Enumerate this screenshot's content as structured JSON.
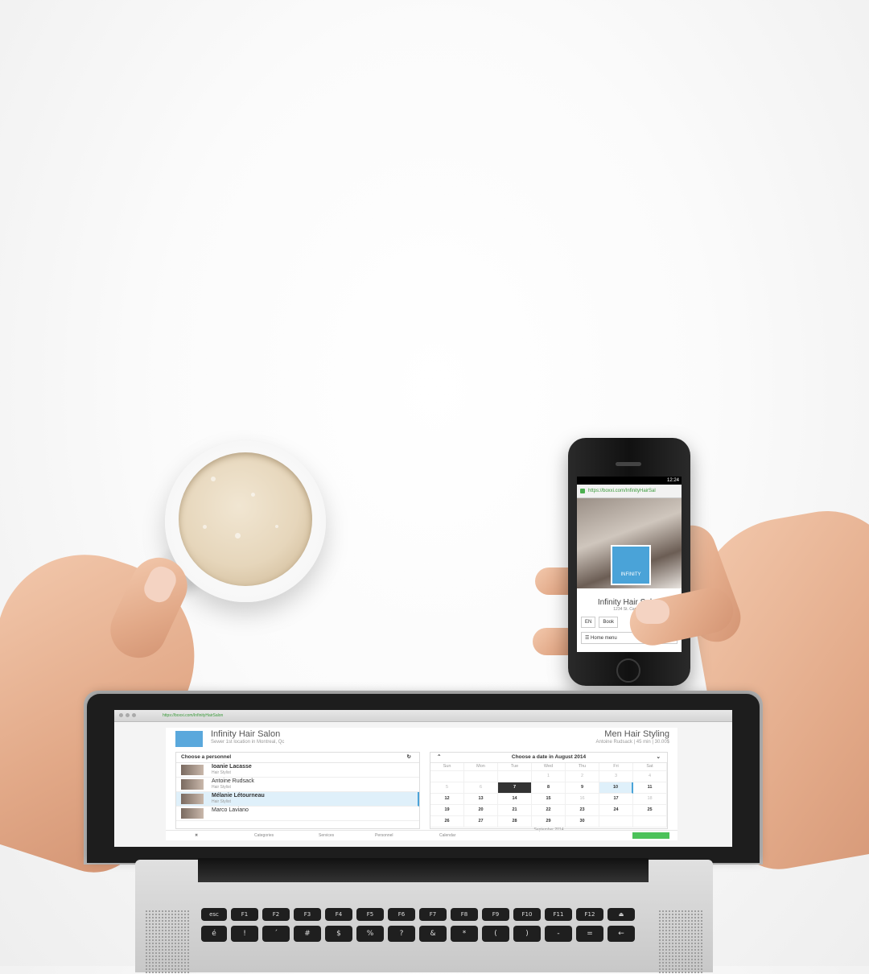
{
  "phone": {
    "status_time": "12:24",
    "url": "https://boxxi.com/InfinityHairSal",
    "logo_text": "INFINITY",
    "salon_name": "Infinity Hair Salon",
    "address": "1234 St. Cam. 1A",
    "lang": "EN",
    "book_label": "Book",
    "menu_label": "Home menu"
  },
  "laptop": {
    "browser_url": "https://boxxi.com/InfinityHairSalon",
    "app": {
      "salon_name": "Infinity Hair Salon",
      "salon_sub": "Sewer 1st location in Montreal, Qc",
      "service_title": "Men Hair Styling",
      "service_sub": "Antoine Rudsack | 45 min | 30.00$",
      "staff_panel_title": "Choose a personnel",
      "staff": [
        {
          "name": "Ioanie Lacasse",
          "role": "Hair Stylist"
        },
        {
          "name": "Antoine Rudsack",
          "role": "Hair Stylist"
        },
        {
          "name": "Mélanie Létourneau",
          "role": "Hair Stylist"
        },
        {
          "name": "Marco Laviano",
          "role": ""
        }
      ],
      "calendar_title": "Choose a date in August 2014",
      "weekdays": [
        "Sun",
        "Mon",
        "Tue",
        "Wed",
        "Thu",
        "Fri",
        "Sat"
      ],
      "weeks": [
        [
          "",
          "",
          "",
          "1",
          "2",
          "3",
          "4"
        ],
        [
          "5",
          "6",
          "7",
          "8",
          "9",
          "10",
          "11"
        ],
        [
          "12",
          "13",
          "14",
          "15",
          "16",
          "17",
          "18"
        ],
        [
          "19",
          "20",
          "21",
          "22",
          "23",
          "24",
          "25"
        ],
        [
          "26",
          "27",
          "28",
          "29",
          "30",
          "",
          ""
        ]
      ],
      "next_month": "September 2014",
      "footer": [
        "Categories",
        "Services",
        "Personnel",
        "Calendar"
      ]
    },
    "keyboard": {
      "fn_row": [
        "esc",
        "F1",
        "F2",
        "F3",
        "F4",
        "F5",
        "F6",
        "F7",
        "F8",
        "F9",
        "F10",
        "F11",
        "F12",
        "⏏"
      ],
      "num_row": [
        "é",
        "!",
        "´",
        "#",
        "$",
        "%",
        "?",
        "&",
        "*",
        "(",
        ")",
        "-",
        "=",
        "←"
      ]
    }
  }
}
